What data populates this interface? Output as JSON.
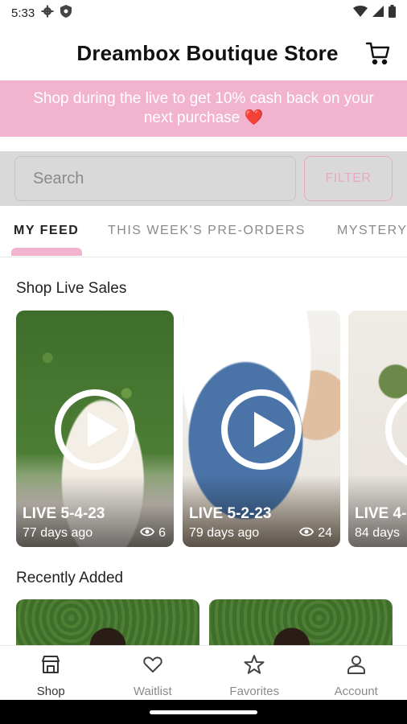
{
  "status_bar": {
    "time": "5:33"
  },
  "header": {
    "title": "Dreambox Boutique Store"
  },
  "promo": {
    "text": "Shop during the live to get 10% cash back on your next purchase ❤️"
  },
  "search": {
    "placeholder": "Search",
    "filter_label": "FILTER"
  },
  "tabs": [
    {
      "label": "MY FEED",
      "active": true
    },
    {
      "label": "THIS WEEK'S PRE-ORDERS",
      "active": false
    },
    {
      "label": "MYSTERY",
      "active": false
    }
  ],
  "live_sales": {
    "title": "Shop Live Sales",
    "cards": [
      {
        "title": "LIVE 5-4-23",
        "ago": "77 days ago",
        "views": "6"
      },
      {
        "title": "LIVE 5-2-23",
        "ago": "79 days ago",
        "views": "24"
      },
      {
        "title": "LIVE 4-",
        "ago": "84 days",
        "views": ""
      }
    ]
  },
  "recently_added": {
    "title": "Recently Added"
  },
  "bottom_nav": [
    {
      "label": "Shop",
      "icon": "shop-icon",
      "active": true
    },
    {
      "label": "Waitlist",
      "icon": "heart-icon",
      "active": false
    },
    {
      "label": "Favorites",
      "icon": "star-icon",
      "active": false
    },
    {
      "label": "Account",
      "icon": "person-icon",
      "active": false
    }
  ],
  "colors": {
    "accent_pink": "#f2b3cf",
    "filter_pink": "#e8a8c4"
  }
}
